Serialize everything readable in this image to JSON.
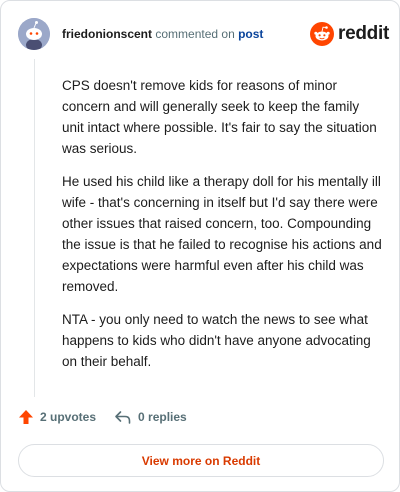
{
  "header": {
    "username": "friedonionscent",
    "action": "commented on",
    "post_link": "post",
    "logo_text": "reddit"
  },
  "comment": {
    "paragraphs": [
      "CPS doesn't remove kids for reasons of minor concern and will generally seek to keep the family unit intact where possible. It's fair to say the situation was serious.",
      "He used his child like a therapy doll for his mentally ill wife - that's concerning in itself but I'd say there were other issues that raised concern, too. Compounding the issue is that he failed to recognise his actions and expectations were harmful even after his child was removed.",
      "NTA - you only need to watch the news to see what happens to kids who didn't have anyone advocating on their behalf."
    ]
  },
  "footer": {
    "upvotes": "2 upvotes",
    "replies": "0 replies",
    "view_more": "View more on Reddit"
  },
  "colors": {
    "accent": "#d93a00",
    "upvote": "#ff4500",
    "link": "#0a449b",
    "meta": "#576f76"
  },
  "icons": {
    "avatar": "snoo-avatar",
    "logo": "reddit-logo-icon",
    "upvote": "upvote-arrow-icon",
    "reply": "reply-arrow-icon"
  }
}
